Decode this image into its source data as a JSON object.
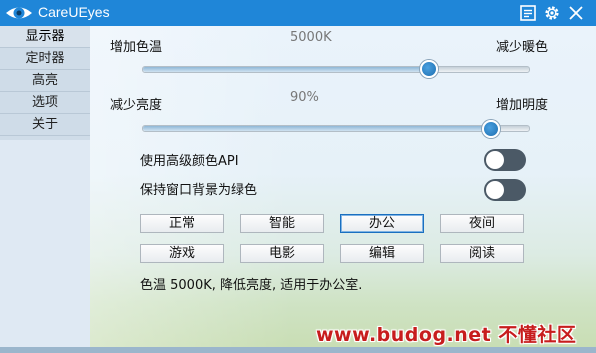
{
  "app": {
    "title": "CareUEyes"
  },
  "sidebar": {
    "items": [
      {
        "label": "显示器"
      },
      {
        "label": "定时器"
      },
      {
        "label": "高亮"
      },
      {
        "label": "选项"
      },
      {
        "label": "关于"
      }
    ]
  },
  "color_temp": {
    "left_label": "增加色温",
    "right_label": "减少暖色",
    "value_label": "5000K",
    "value_fraction": 0.74
  },
  "brightness": {
    "left_label": "减少亮度",
    "right_label": "增加明度",
    "value_label": "90%",
    "value_fraction": 0.9
  },
  "options": {
    "advanced_color_api": {
      "label": "使用高级颜色API"
    },
    "window_bg_green": {
      "label": "保持窗口背景为绿色"
    }
  },
  "modes": [
    {
      "label": "正常"
    },
    {
      "label": "智能"
    },
    {
      "label": "办公"
    },
    {
      "label": "夜间"
    },
    {
      "label": "游戏"
    },
    {
      "label": "电影"
    },
    {
      "label": "编辑"
    },
    {
      "label": "阅读"
    }
  ],
  "status_text": "色温 5000K, 降低亮度, 适用于办公室.",
  "watermark": "www.budog.net 不懂社区",
  "colors": {
    "titlebar": "#1f86d8",
    "accent": "#1a6fc0",
    "toggle_off": "#4b5966"
  },
  "icons": {
    "app": "eye-icon",
    "notes": "notepad-icon",
    "settings": "gear-icon",
    "close": "close-icon"
  }
}
